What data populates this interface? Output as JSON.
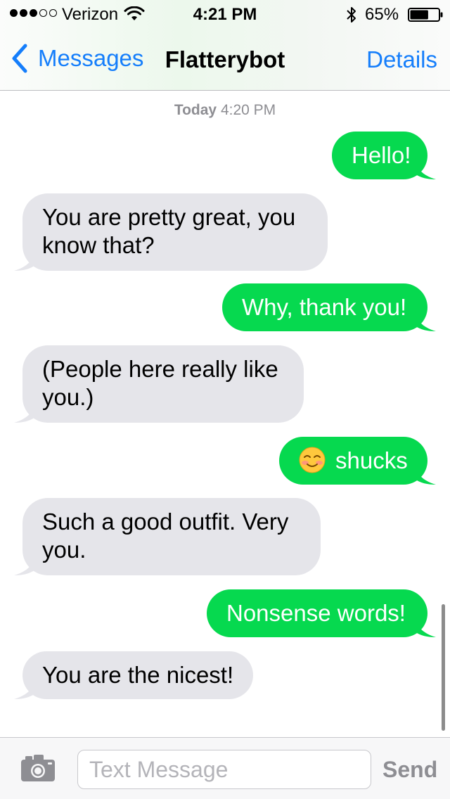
{
  "status_bar": {
    "signal_bars_filled": 3,
    "signal_bars_total": 5,
    "carrier": "Verizon",
    "time": "4:21 PM",
    "battery_percent": "65%",
    "battery_level": 0.65,
    "icons": [
      "signal-dots",
      "wifi-icon",
      "bluetooth-icon",
      "battery-icon"
    ]
  },
  "nav": {
    "back_label": "Messages",
    "title": "Flatterybot",
    "details_label": "Details",
    "accent_color": "#157efb"
  },
  "conversation": {
    "timestamp_day": "Today",
    "timestamp_time": "4:20 PM",
    "outgoing_color": "#06d94f",
    "incoming_color": "#e5e5ea",
    "messages": [
      {
        "direction": "outgoing",
        "text": "Hello!"
      },
      {
        "direction": "incoming",
        "text": "You are pretty great, you know that?"
      },
      {
        "direction": "outgoing",
        "text": "Why, thank you!"
      },
      {
        "direction": "incoming",
        "text": "(People here really like you.)"
      },
      {
        "direction": "outgoing",
        "emoji": "smiling-face-emoji",
        "text": "shucks"
      },
      {
        "direction": "incoming",
        "text": "Such a good outfit. Very you."
      },
      {
        "direction": "outgoing",
        "text": "Nonsense words!"
      },
      {
        "direction": "incoming",
        "text": "You are the nicest!"
      }
    ]
  },
  "input_bar": {
    "camera_icon": "camera-icon",
    "placeholder": "Text Message",
    "value": "",
    "send_label": "Send"
  }
}
